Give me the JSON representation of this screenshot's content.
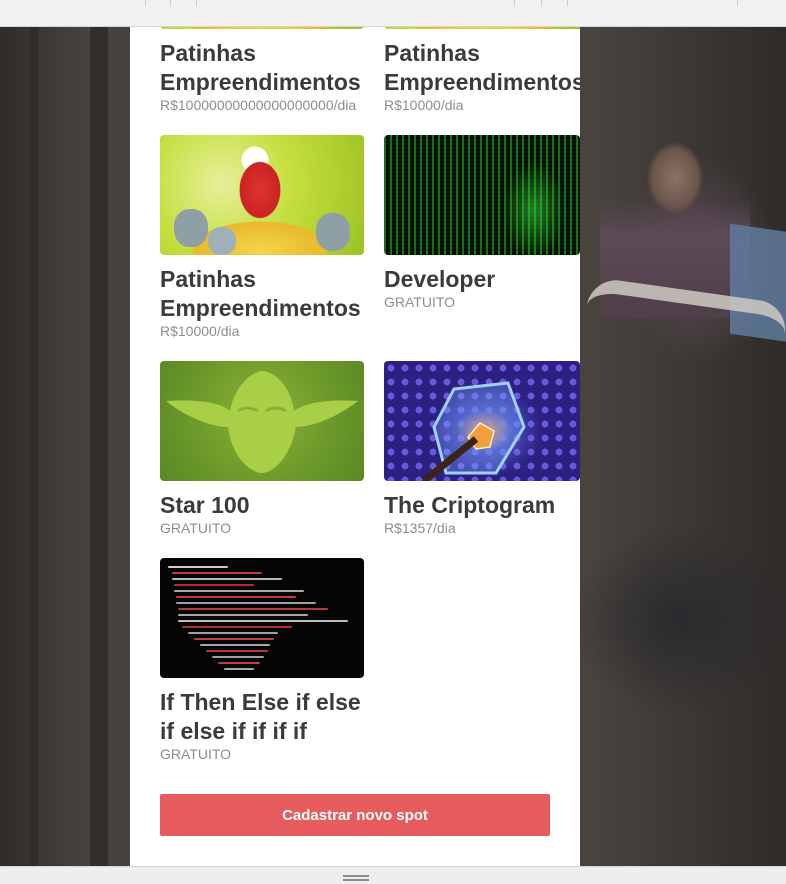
{
  "spots": [
    {
      "title": "Patinhas Empreendimentos",
      "price": "R$10000000000000000000/dia",
      "image": "scrooge-mcduck-coins"
    },
    {
      "title": "Patinhas Empreendimentos",
      "price": "R$10000/dia",
      "image": "scrooge-mcduck-coins"
    },
    {
      "title": "Patinhas Empreendimentos",
      "price": "R$10000/dia",
      "image": "scrooge-mcduck-coins"
    },
    {
      "title": "Developer",
      "price": "GRATUITO",
      "image": "matrix-code-face"
    },
    {
      "title": "Star 100",
      "price": "GRATUITO",
      "image": "yoda-silhouette"
    },
    {
      "title": "The Criptogram",
      "price": "R$1357/dia",
      "image": "hexagon-cube"
    },
    {
      "title": "If Then Else if else if else if if if if",
      "price": "GRATUITO",
      "image": "code-screenshot"
    }
  ],
  "actions": {
    "register_spot": "Cadastrar novo spot"
  },
  "colors": {
    "accent": "#e55b5e",
    "title_text": "#3b3b3b",
    "price_text": "#8d8d8d",
    "panel": "#ffffff"
  }
}
